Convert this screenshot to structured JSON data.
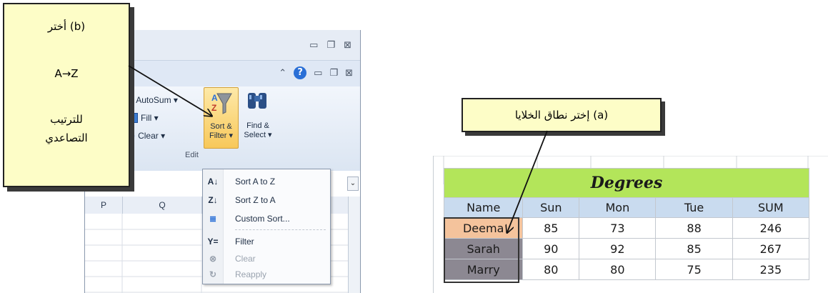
{
  "excel": {
    "edit_commands": [
      {
        "label": "AutoSum ▾",
        "icon": "sigma-icon"
      },
      {
        "label": "Fill ▾",
        "icon": "fill-down-icon"
      },
      {
        "label": "Clear ▾",
        "icon": "eraser-icon"
      }
    ],
    "sort_filter_button": {
      "line1": "Sort &",
      "line2": "Filter ▾"
    },
    "find_select_button": {
      "line1": "Find &",
      "line2": "Select ▾"
    },
    "group_label": "Edit",
    "columns": [
      "P",
      "Q"
    ],
    "menu": [
      {
        "label": "Sort A to Z",
        "icon": "A↓",
        "enabled": true
      },
      {
        "label": "Sort Z to A",
        "icon": "Z↓",
        "enabled": true
      },
      {
        "label": "Custom Sort...",
        "icon": "≣",
        "enabled": true
      },
      {
        "label": "Filter",
        "icon": "Y=",
        "enabled": true
      },
      {
        "label": "Clear",
        "icon": "⊗",
        "enabled": false
      },
      {
        "label": "Reapply",
        "icon": "↻",
        "enabled": false
      }
    ]
  },
  "callout_b": {
    "line1": "(b) أختر",
    "line2": "A→Z",
    "line3": "للترتيب",
    "line4": "التصاعدي"
  },
  "callout_a": {
    "text": "(a) إختر نطاق الخلايا"
  },
  "sheet": {
    "title": "Degrees",
    "headers": [
      "Name",
      "Sun",
      "Mon",
      "Tue",
      "SUM"
    ],
    "rows": [
      [
        "Deema",
        "85",
        "73",
        "88",
        "246"
      ],
      [
        "Sarah",
        "90",
        "92",
        "85",
        "267"
      ],
      [
        "Marry",
        "80",
        "80",
        "75",
        "235"
      ]
    ],
    "colors": {
      "title_bg": "#b3e55a",
      "header_bg": "#c9dbef",
      "deema_bg": "#f4c39c",
      "name_bg": "#8c8892"
    }
  }
}
